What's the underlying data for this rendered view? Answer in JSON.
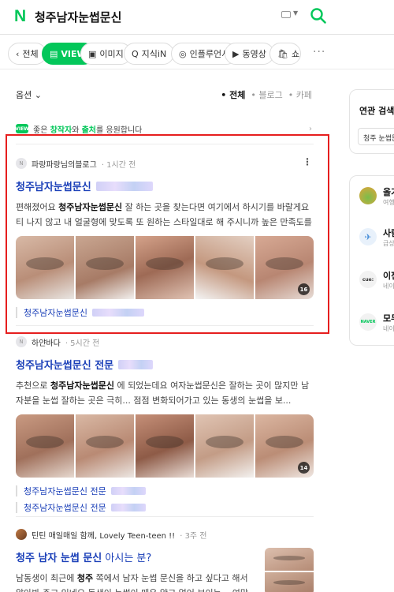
{
  "header": {
    "logo": "N",
    "query": "청주남자눈썹문신"
  },
  "tabs": [
    {
      "icon": "‹",
      "label": "전체"
    },
    {
      "icon": "▤",
      "label": "VIEW"
    },
    {
      "icon": "▣",
      "label": "이미지"
    },
    {
      "icon": "Q",
      "label": "지식iN"
    },
    {
      "icon": "◎",
      "label": "인플루언서"
    },
    {
      "icon": "▶",
      "label": "동영상"
    },
    {
      "icon": "🛍",
      "label": "쇼"
    }
  ],
  "more_label": "···",
  "options": {
    "label": "옵션",
    "sorts": [
      "전체",
      "블로그",
      "카페"
    ]
  },
  "notice": {
    "badge": "VIEW",
    "prefix": "좋은 ",
    "em1": "창작자",
    "mid": "와 ",
    "em2": "출처",
    "suffix": "를 응원합니다"
  },
  "posts": [
    {
      "avatar": "N",
      "author": "파랑파랑님의블로그",
      "time": "1시간 전",
      "title": "청주남자눈썹문신",
      "snippet_pre": "편해졌어요 ",
      "snippet_bold": "청주남자눈썹문신",
      "snippet_post": " 잘 하는 곳을 찾는다면 여기에서 하시기를 바랄게요 티 나지 않고 내 얼굴형에 맞도록 또 원하는 스타일대로 해 주시니까 높은 만족도를 느낄 수 ...",
      "photo_count": "16",
      "sublinks": [
        "청주남자눈썹문신"
      ]
    },
    {
      "avatar": "N",
      "author": "하얀바다",
      "time": "5시간 전",
      "title": "청주남자눈썹문신 전문",
      "snippet_pre": "추천으로 ",
      "snippet_bold": "청주남자눈썹문신",
      "snippet_post": " 에 되었는데요 여자눈썹문신은 잘하는 곳이 많지만 남자분을 눈썹 잘하는 곳은 극히... 점점 변화되어가고 있는 동생의 눈썹을 보...",
      "photo_count": "14",
      "sublinks": [
        "청주남자눈썹문신 전문",
        "청주남자눈썹문신 전문"
      ]
    },
    {
      "avatar": "",
      "author": "틴틴 매일매일 함께, Lovely Teen-teen !!",
      "time": "3주 전",
      "title_a": "청주 남자 눈썹 문신",
      "title_b": " 아시는 분?",
      "snippet_pre": "남동생이 최근에 ",
      "snippet_bold": "청주",
      "snippet_post": " 쪽에서 남자 눈썹 문신을 하고 싶다고 해서 알아봐 주고 있네요 동생이 눈썹이 매우 얇고 없어 보이는... 여맘이 다가오기 전"
    }
  ],
  "sidebar": {
    "related_title": "연관 검색어",
    "related_chip": "청주 눈썹문신",
    "items": [
      {
        "name": "올가",
        "sub": "여행·생",
        "icon": ""
      },
      {
        "name": "사람",
        "sub": "급상·",
        "icon": "✈"
      },
      {
        "name": "이젠",
        "sub": "네이",
        "icon": "cue:"
      },
      {
        "name": "모두",
        "sub": "네이",
        "icon": "NAVER"
      }
    ]
  },
  "colors": {
    "brand": "#03c75a",
    "link": "#1a3fb8",
    "highlight": "#e61e1e"
  }
}
